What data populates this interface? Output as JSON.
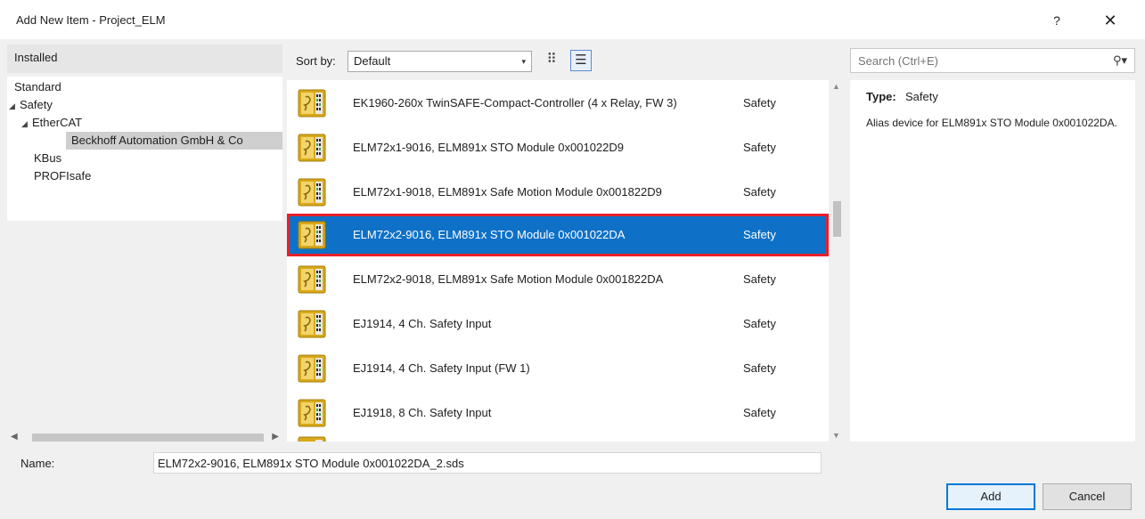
{
  "window": {
    "title": "Add New Item - Project_ELM",
    "help_label": "?",
    "close_label": "✕"
  },
  "left_panel": {
    "header": "Installed",
    "tree": [
      {
        "label": "Standard",
        "arrow": ""
      },
      {
        "label": "Safety",
        "arrow": "◢"
      },
      {
        "label": "EtherCAT",
        "arrow": "◢"
      },
      {
        "label": "Beckhoff Automation GmbH & Co",
        "arrow": "",
        "selected": true
      },
      {
        "label": "KBus",
        "arrow": ""
      },
      {
        "label": "PROFIsafe",
        "arrow": ""
      }
    ],
    "scroll_left": "◀",
    "scroll_right": "▶"
  },
  "toolbar": {
    "sort_label": "Sort by:",
    "sort_value": "Default",
    "caret": "▾",
    "grid_view_icon": "small-icons-view-icon",
    "list_view_icon": "details-view-icon",
    "grid_glyph": "⠿",
    "list_glyph": "☰"
  },
  "items": [
    {
      "name": "EK1960-260x TwinSAFE-Compact-Controller (4 x Relay, FW 3)",
      "category": "Safety"
    },
    {
      "name": "ELM72x1-9016, ELM891x STO Module 0x001022D9",
      "category": "Safety"
    },
    {
      "name": "ELM72x1-9018, ELM891x Safe Motion Module 0x001822D9",
      "category": "Safety"
    },
    {
      "name": "ELM72x2-9016, ELM891x STO Module 0x001022DA",
      "category": "Safety",
      "selected": true
    },
    {
      "name": "ELM72x2-9018, ELM891x Safe Motion Module 0x001822DA",
      "category": "Safety"
    },
    {
      "name": "EJ1914, 4 Ch. Safety Input",
      "category": "Safety"
    },
    {
      "name": "EJ1914, 4 Ch. Safety Input (FW 1)",
      "category": "Safety"
    },
    {
      "name": "EJ1918, 8 Ch. Safety Input",
      "category": "Safety"
    }
  ],
  "list_scroll": {
    "up": "▲",
    "down": "▼"
  },
  "search": {
    "placeholder": "Search (Ctrl+E)",
    "icon_glyph": "⚲▾"
  },
  "details": {
    "type_label": "Type:",
    "type_value": "Safety",
    "description": "Alias device for ELM891x STO Module 0x001022DA."
  },
  "bottom": {
    "name_label": "Name:",
    "name_value": "ELM72x2-9016, ELM891x STO Module 0x001022DA_2.sds",
    "add_label": "Add",
    "cancel_label": "Cancel"
  },
  "colors": {
    "selection": "#0e71c7",
    "highlight_border": "#e8202a",
    "icon_gold": "#d9a919"
  }
}
